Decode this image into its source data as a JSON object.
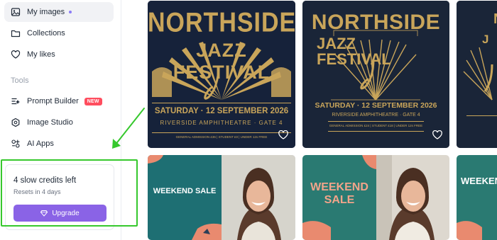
{
  "sidebar": {
    "items": [
      {
        "label": "My images",
        "icon": "image-icon"
      },
      {
        "label": "Collections",
        "icon": "folder-icon"
      },
      {
        "label": "My likes",
        "icon": "heart-icon"
      }
    ],
    "tools_label": "Tools",
    "tools": [
      {
        "label": "Prompt Builder",
        "icon": "prompt-builder-icon",
        "badge": "NEW"
      },
      {
        "label": "Image Studio",
        "icon": "image-studio-icon"
      },
      {
        "label": "AI Apps",
        "icon": "ai-apps-icon"
      }
    ],
    "credits": {
      "title": "4 slow credits left",
      "subtitle": "Resets in 4 days",
      "button_label": "Upgrade"
    }
  },
  "gallery": {
    "posters": [
      {
        "line1": "NORTHSIDE",
        "line2": "JAZZ FESTIVAL",
        "date": "SATURDAY · 12 SEPTEMBER 2026",
        "venue": "RIVERSIDE AMPHITHEATRE · GATE 4",
        "admission": "GENERAL ADMISSION £36 | STUDENT £0 | UNDER 12s FREE"
      },
      {
        "line1": "NORTHSIDE",
        "line2": "JAZZ FESTIVAL",
        "date": "SATURDAY · 12 SEPTEMBER 2026",
        "venue": "RIVERSIDE AMPHITHEATRE · GATE 4",
        "admission": "GENERAL ADMISSION £24 | STUDENT £18 | UNDER 12s FREE"
      }
    ],
    "sales": [
      {
        "text": "WEEKEND SALE"
      },
      {
        "line1": "WEEKEND",
        "line2": "SALE"
      },
      {
        "line1": "WEEKEN"
      }
    ]
  },
  "colors": {
    "accent": "#8a63e6",
    "badge": "#ff4d5e",
    "highlight": "#36c82d",
    "poster_bg": "#16223a",
    "poster_gold": "#c9a55a",
    "sale_teal": "#1e6f73",
    "sale_coral": "#e98a6f"
  }
}
